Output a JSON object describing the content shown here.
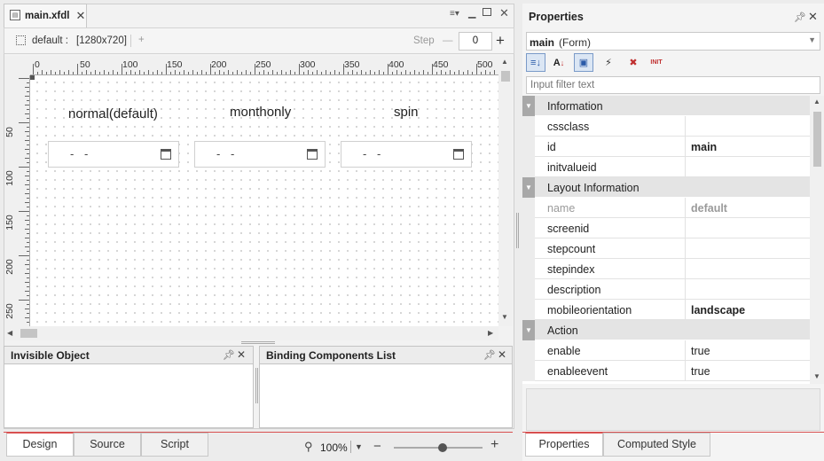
{
  "editor": {
    "tab_title": "main.xfdl",
    "toolbar": {
      "layout_name": "default :",
      "resolution": "[1280x720]",
      "add_symbol": "+",
      "step_label": "Step",
      "step_value": "0",
      "minus_symbol": "—",
      "plus_symbol": "+"
    },
    "ruler_top": [
      "0",
      "50",
      "100",
      "150",
      "200",
      "250",
      "300",
      "350",
      "400",
      "450",
      "500"
    ],
    "ruler_left": [
      "50",
      "100",
      "150",
      "200",
      "250"
    ],
    "canvas": {
      "labels": [
        "normal(default)",
        "monthonly",
        "spin"
      ],
      "calendars": [
        {
          "text": "- -"
        },
        {
          "text": "- -"
        },
        {
          "text": "- -"
        }
      ]
    }
  },
  "bottom_panels": {
    "invisible_object": "Invisible Object",
    "binding_components": "Binding Components List"
  },
  "bottom_tabs": [
    "Design",
    "Source",
    "Script"
  ],
  "zoom": {
    "value": "100%",
    "zoom_level": 0.55
  },
  "properties": {
    "title": "Properties",
    "object_name": "main",
    "object_type": "(Form)",
    "filter_placeholder": "Input filter text",
    "categories": {
      "information": "Information",
      "layout_information": "Layout Information",
      "action": "Action"
    },
    "rows": {
      "cssclass": {
        "key": "cssclass",
        "value": ""
      },
      "id": {
        "key": "id",
        "value": "main"
      },
      "initvalueid": {
        "key": "initvalueid",
        "value": ""
      },
      "name": {
        "key": "name",
        "value": "default"
      },
      "screenid": {
        "key": "screenid",
        "value": ""
      },
      "stepcount": {
        "key": "stepcount",
        "value": ""
      },
      "stepindex": {
        "key": "stepindex",
        "value": ""
      },
      "description": {
        "key": "description",
        "value": ""
      },
      "mobileorientation": {
        "key": "mobileorientation",
        "value": "landscape"
      },
      "enable": {
        "key": "enable",
        "value": "true"
      },
      "enableevent": {
        "key": "enableevent",
        "value": "true"
      }
    },
    "tabs": [
      "Properties",
      "Computed Style"
    ],
    "init_label": "INIT"
  },
  "colors": {
    "accent_red": "#d85050",
    "category_bg": "#e4e4e4",
    "toggle_gray": "#a8a8a8"
  }
}
